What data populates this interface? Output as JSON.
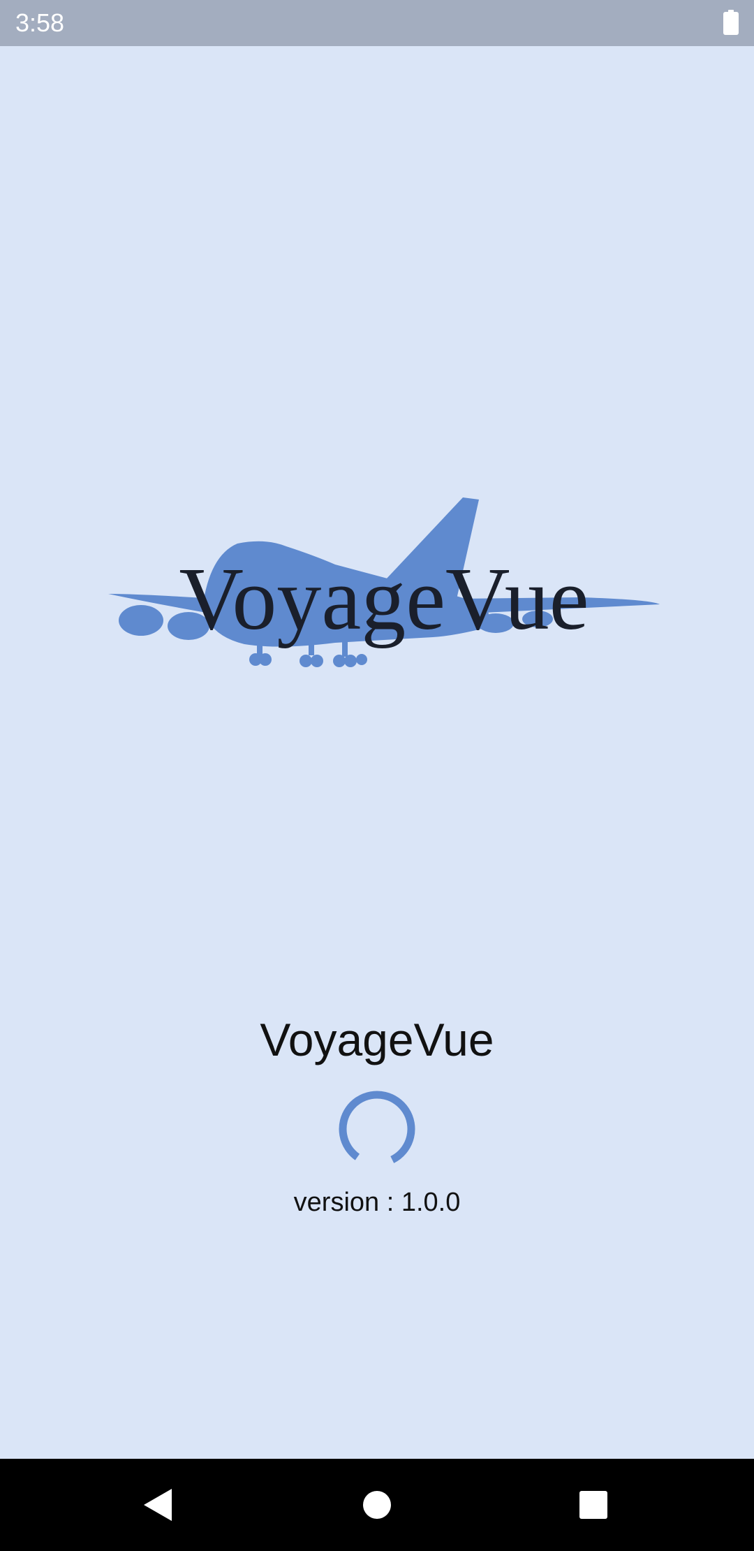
{
  "status_bar": {
    "time": "3:58",
    "battery_icon": "battery-full-icon"
  },
  "logo": {
    "text": "VoyageVue",
    "icon": "airplane-silhouette"
  },
  "splash": {
    "app_name": "VoyageVue",
    "version_text": "version : 1.0.0"
  },
  "navigation": {
    "back_icon": "back-triangle-icon",
    "home_icon": "home-circle-icon",
    "recents_icon": "recents-square-icon"
  },
  "colors": {
    "background": "#dae5f7",
    "status_bar": "#a3adbf",
    "accent": "#5f8acf",
    "nav_bar": "#000000"
  }
}
